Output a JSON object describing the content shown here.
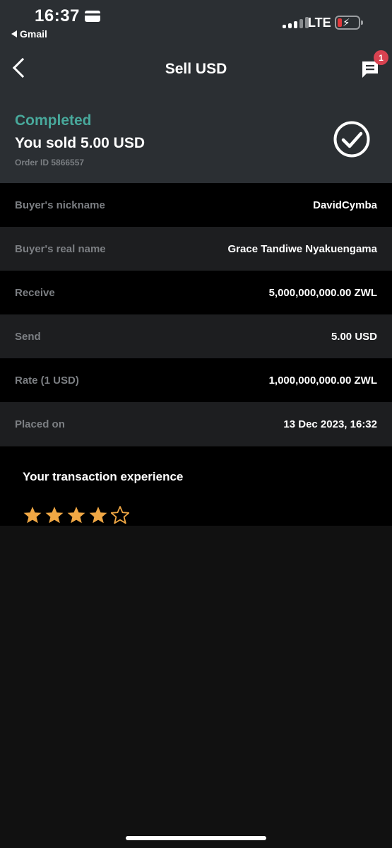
{
  "status_bar": {
    "time": "16:37",
    "back_app": "Gmail",
    "network": "LTE"
  },
  "nav": {
    "title": "Sell USD",
    "chat_badge": "1"
  },
  "summary": {
    "status": "Completed",
    "title": "You sold 5.00 USD",
    "order_id": "Order ID 5866557"
  },
  "details": [
    {
      "label": "Buyer's nickname",
      "value": "DavidCymba"
    },
    {
      "label": "Buyer's real name",
      "value": "Grace Tandiwe Nyakuengama"
    },
    {
      "label": "Receive",
      "value": "5,000,000,000.00 ZWL"
    },
    {
      "label": "Send",
      "value": "5.00 USD"
    },
    {
      "label": "Rate (1 USD)",
      "value": "1,000,000,000.00 ZWL"
    },
    {
      "label": "Placed on",
      "value": "13 Dec 2023, 16:32"
    }
  ],
  "experience": {
    "title": "Your transaction experience",
    "rating": 4,
    "max_rating": 5
  },
  "colors": {
    "accent_green": "#48a89b",
    "star": "#f0a744",
    "badge": "#d84250"
  }
}
